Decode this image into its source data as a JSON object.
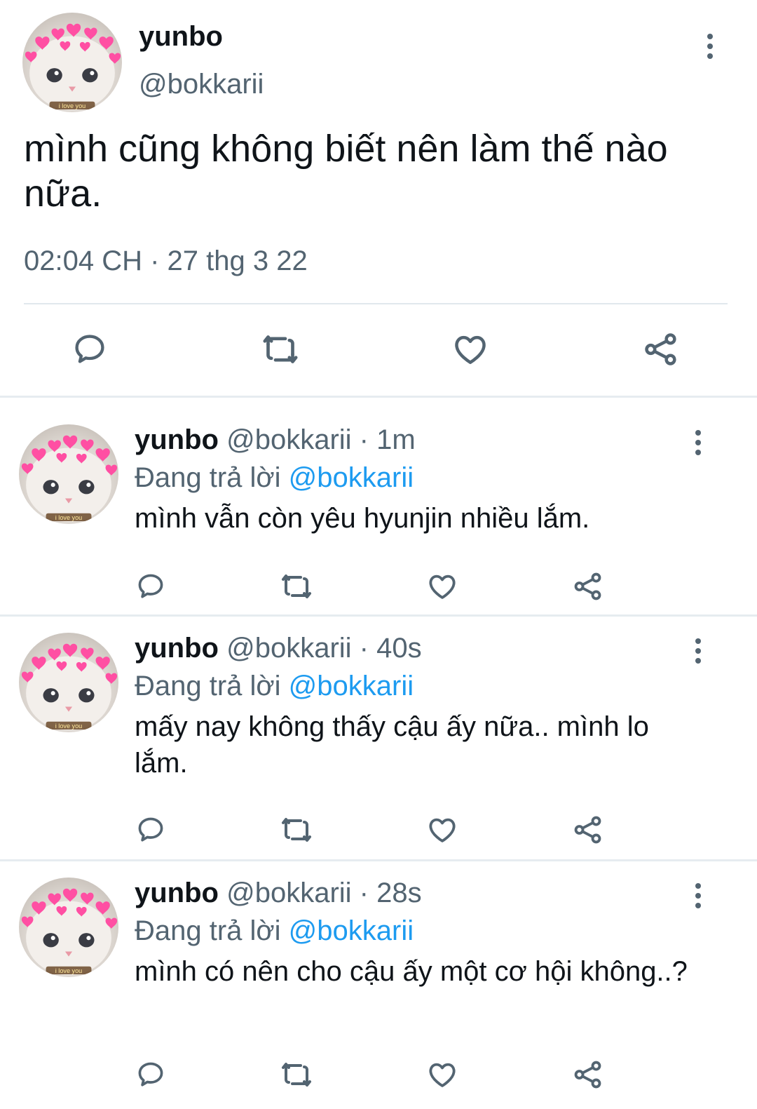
{
  "main_tweet": {
    "name": "yunbo",
    "handle": "@bokkarii",
    "text": "mình cũng không biết nên làm thế nào nữa.",
    "timestamp": "02:04 CH · 27 thg 3 22",
    "avatar_caption": "i love you"
  },
  "replies": [
    {
      "name": "yunbo",
      "handle": "@bokkarii",
      "dot": "·",
      "time": "1m",
      "replying_label": "Đang trả lời",
      "mention": "@bokkarii",
      "text": "mình vẫn còn yêu hyunjin nhiều lắm.",
      "avatar_caption": "i love you"
    },
    {
      "name": "yunbo",
      "handle": "@bokkarii",
      "dot": "·",
      "time": "40s",
      "replying_label": "Đang trả lời",
      "mention": "@bokkarii",
      "text": "mấy nay không thấy cậu ấy nữa.. mình lo lắm.",
      "avatar_caption": "i love you"
    },
    {
      "name": "yunbo",
      "handle": "@bokkarii",
      "dot": "·",
      "time": "28s",
      "replying_label": "Đang trả lời",
      "mention": "@bokkarii",
      "text": "mình có nên cho cậu ấy một cơ hội không..?",
      "avatar_caption": "i love you"
    }
  ],
  "icons": [
    "more-options-icon",
    "reply-icon",
    "retweet-icon",
    "like-icon",
    "share-icon"
  ],
  "colors": {
    "text": "#0f1419",
    "secondary": "#536471",
    "mention": "#1d9bf0",
    "divider": "#e1e8ed",
    "hearts": "#ff4fa3"
  }
}
